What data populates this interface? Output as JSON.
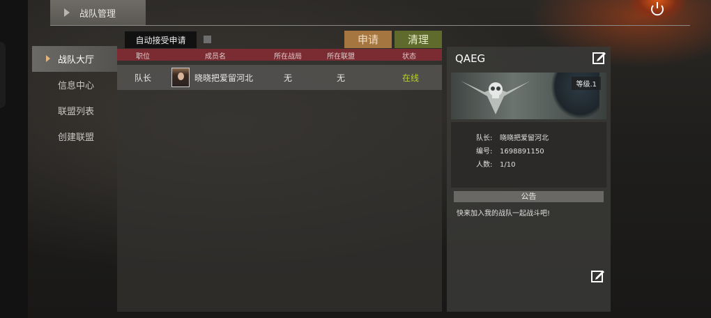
{
  "header": {
    "breadcrumb": "战队管理",
    "power_icon": "power-icon"
  },
  "sidebar": {
    "items": [
      {
        "label": "战队大厅",
        "active": true
      },
      {
        "label": "信息中心",
        "active": false
      },
      {
        "label": "联盟列表",
        "active": false
      },
      {
        "label": "创建联盟",
        "active": false
      }
    ]
  },
  "toolbar": {
    "auto_accept_label": "自动接受申请",
    "apply_label": "申请",
    "clear_label": "清理"
  },
  "members": {
    "columns": [
      "职位",
      "成员名",
      "所在战局",
      "所在联盟",
      "状态"
    ],
    "rows": [
      {
        "role": "队长",
        "name": "晓晓把爱留河北",
        "match": "无",
        "alliance": "无",
        "status": "在线"
      }
    ]
  },
  "team": {
    "name": "QAEG",
    "level": "等级.1",
    "leader_label": "队长:",
    "leader": "晓晓把爱留河北",
    "id_label": "编号:",
    "id": "1698891150",
    "count_label": "人数:",
    "count": "1/10",
    "notice_title": "公告",
    "notice": "快来加入我的战队一起战斗吧!"
  },
  "colors": {
    "header_red": "#7b2c33",
    "apply": "#a5763f",
    "clear": "#5f6a2d",
    "online": "#b9d12a",
    "active_arrow": "#e3b680"
  }
}
